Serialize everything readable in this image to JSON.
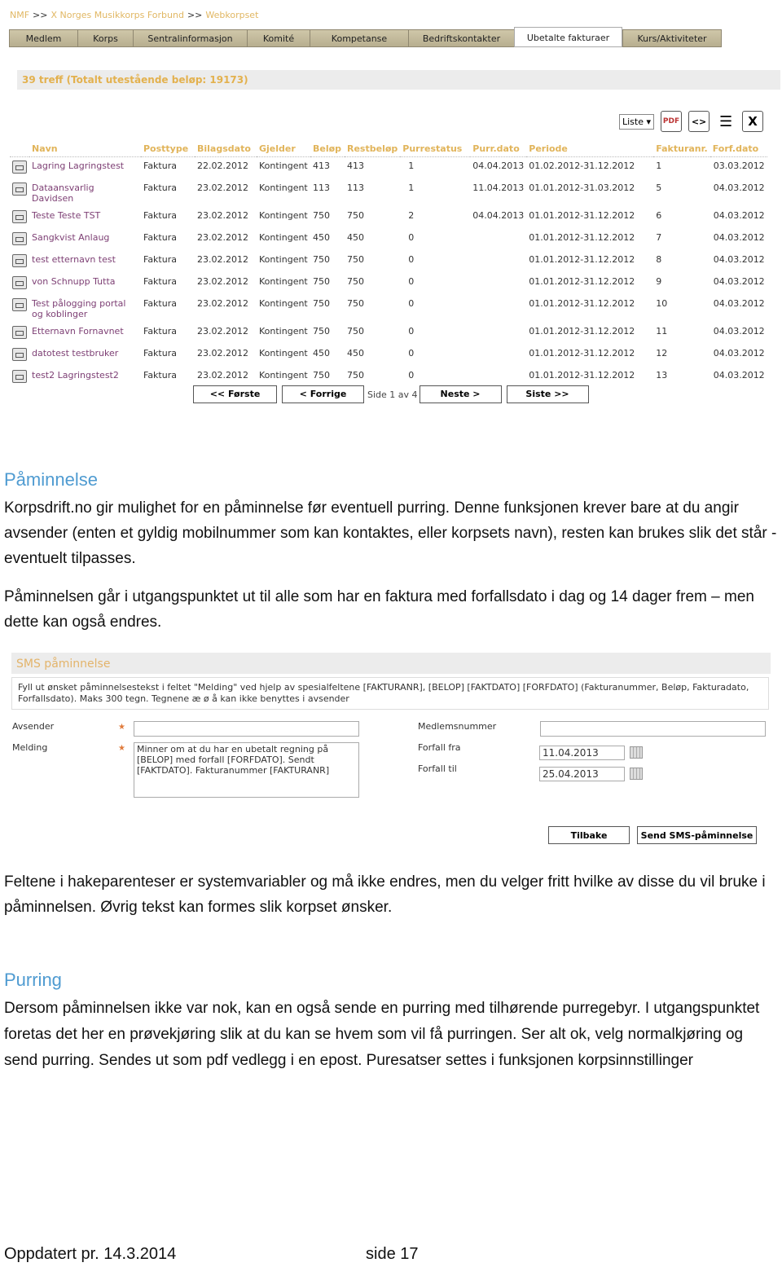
{
  "breadcrumb": [
    "NMF",
    "X Norges Musikkorps Forbund",
    "Webkorpset"
  ],
  "breadcrumb_sep": ">>",
  "nav": [
    {
      "label": "Medlem",
      "active": false
    },
    {
      "label": "Korps",
      "active": false
    },
    {
      "label": "Sentralinformasjon",
      "active": false
    },
    {
      "label": "Komité",
      "active": false
    },
    {
      "label": "Kompetanse",
      "active": false
    },
    {
      "label": "Bedriftskontakter",
      "active": false
    },
    {
      "label": "Ubetalte fakturaer",
      "active": true
    },
    {
      "label": "Kurs/Aktiviteter",
      "active": false
    }
  ],
  "treff": "39 treff (Totalt utestående beløp: 19173)",
  "toolbar": {
    "view_select": "Liste",
    "icons": [
      "pdf-icon",
      "xml-icon",
      "list-icon",
      "excel-icon"
    ]
  },
  "table": {
    "headers": [
      "Navn",
      "Posttype",
      "Bilagsdato",
      "Gjelder",
      "Beløp",
      "Restbeløp",
      "Purrestatus",
      "Purr.dato",
      "Periode",
      "Fakturanr.",
      "Forf.dato"
    ],
    "rows": [
      [
        "Lagring Lagringstest",
        "Faktura",
        "22.02.2012",
        "Kontingent",
        "413",
        "413",
        "1",
        "04.04.2013",
        "01.02.2012-31.12.2012",
        "1",
        "03.03.2012"
      ],
      [
        "Dataansvarlig Davidsen",
        "Faktura",
        "23.02.2012",
        "Kontingent",
        "113",
        "113",
        "1",
        "11.04.2013",
        "01.01.2012-31.03.2012",
        "5",
        "04.03.2012"
      ],
      [
        "Teste Teste TST",
        "Faktura",
        "23.02.2012",
        "Kontingent",
        "750",
        "750",
        "2",
        "04.04.2013",
        "01.01.2012-31.12.2012",
        "6",
        "04.03.2012"
      ],
      [
        "Sangkvist Anlaug",
        "Faktura",
        "23.02.2012",
        "Kontingent",
        "450",
        "450",
        "0",
        "",
        "01.01.2012-31.12.2012",
        "7",
        "04.03.2012"
      ],
      [
        "test etternavn test",
        "Faktura",
        "23.02.2012",
        "Kontingent",
        "750",
        "750",
        "0",
        "",
        "01.01.2012-31.12.2012",
        "8",
        "04.03.2012"
      ],
      [
        "von Schnupp Tutta",
        "Faktura",
        "23.02.2012",
        "Kontingent",
        "750",
        "750",
        "0",
        "",
        "01.01.2012-31.12.2012",
        "9",
        "04.03.2012"
      ],
      [
        "Test pålogging portal og koblinger",
        "Faktura",
        "23.02.2012",
        "Kontingent",
        "750",
        "750",
        "0",
        "",
        "01.01.2012-31.12.2012",
        "10",
        "04.03.2012"
      ],
      [
        "Etternavn Fornavnet",
        "Faktura",
        "23.02.2012",
        "Kontingent",
        "750",
        "750",
        "0",
        "",
        "01.01.2012-31.12.2012",
        "11",
        "04.03.2012"
      ],
      [
        "datotest testbruker",
        "Faktura",
        "23.02.2012",
        "Kontingent",
        "450",
        "450",
        "0",
        "",
        "01.01.2012-31.12.2012",
        "12",
        "04.03.2012"
      ],
      [
        "test2 Lagringstest2",
        "Faktura",
        "23.02.2012",
        "Kontingent",
        "750",
        "750",
        "0",
        "",
        "01.01.2012-31.12.2012",
        "13",
        "04.03.2012"
      ]
    ]
  },
  "pager": {
    "first": "<< Første",
    "prev": "< Forrige",
    "status": "Side 1 av 4",
    "next": "Neste >",
    "last": "Siste >>"
  },
  "section1": {
    "title": "Påminnelse",
    "p1": "Korpsdrift.no gir mulighet for en påminnelse før eventuell purring. Denne funksjonen krever bare at du angir avsender (enten et gyldig mobilnummer som kan kontaktes, eller korpsets navn), resten kan brukes slik det står  - eventuelt tilpasses.",
    "p2": "Påminnelsen går i utgangspunktet ut til alle som har en faktura med forfallsdato i dag og 14 dager frem – men dette kan også endres."
  },
  "sms": {
    "title": "SMS påminnelse",
    "info": "Fyll ut ønsket påminnelsestekst i feltet \"Melding\" ved hjelp av spesialfeltene [FAKTURANR], [BELOP] [FAKTDATO] [FORFDATO] (Fakturanummer, Beløp, Fakturadato, Forfallsdato). Maks 300 tegn. Tegnene æ ø å kan ikke benyttes i avsender",
    "avsender_label": "Avsender",
    "avsender_value": "",
    "melding_label": "Melding",
    "melding_value": "Minner om at du har en ubetalt regning på [BELOP] med forfall [FORFDATO]. Sendt [FAKTDATO]. Fakturanummer [FAKTURANR]",
    "medlemsnummer_label": "Medlemsnummer",
    "medlemsnummer_value": "",
    "forfall_fra_label": "Forfall fra",
    "forfall_fra_value": "11.04.2013",
    "forfall_til_label": "Forfall til",
    "forfall_til_value": "25.04.2013",
    "back_label": "Tilbake",
    "send_label": "Send SMS-påminnelse"
  },
  "section1_after": "Feltene i hakeparenteser er systemvariabler og må ikke endres, men du velger fritt hvilke av disse du vil bruke i påminnelsen. Øvrig tekst kan formes slik korpset ønsker.",
  "section2": {
    "title": "Purring",
    "p1": "Dersom påminnelsen ikke var nok, kan en også sende en purring med tilhørende purregebyr. I utgangspunktet foretas det her en prøvekjøring slik at du kan se hvem som vil få purringen. Ser alt ok, velg normalkjøring og send purring. Sendes ut som pdf vedlegg i en epost. Puresatser settes i funksjonen korpsinnstillinger"
  },
  "footer": {
    "updated": "Oppdatert pr. 14.3.2014",
    "page": "side 17"
  }
}
